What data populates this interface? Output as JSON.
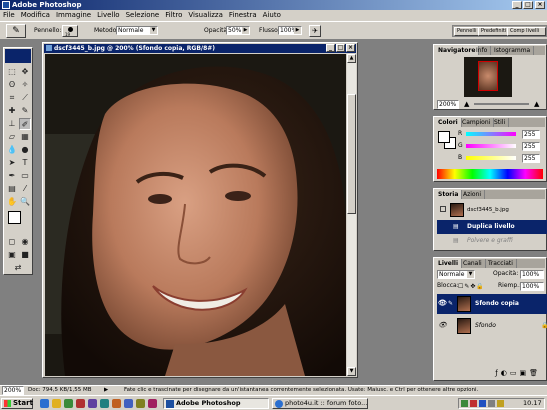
{
  "app": {
    "title": "Adobe Photoshop"
  },
  "menu": [
    "File",
    "Modifica",
    "Immagine",
    "Livello",
    "Selezione",
    "Filtro",
    "Visualizza",
    "Finestra",
    "Aiuto"
  ],
  "options": {
    "brush_label": "Pennello:",
    "brush_size": "19",
    "mode_label": "Metodo:",
    "mode_value": "Normale",
    "opacity_label": "Opacità:",
    "opacity_value": "50%",
    "flow_label": "Flusso:",
    "flow_value": "100%"
  },
  "panel_well": {
    "tab1": "Pennelli",
    "tab2": "Predefiniti",
    "tab3": "Comp livelli"
  },
  "document": {
    "title": "dscf3445_b.jpg @ 200% (Sfondo copia, RGB/8#)"
  },
  "navigator": {
    "tabs": [
      "Navigatore",
      "Info",
      "Istogramma"
    ],
    "zoom": "200%"
  },
  "color": {
    "tabs": [
      "Colori",
      "Campioni",
      "Stili"
    ],
    "channels": [
      {
        "label": "R",
        "value": "255",
        "gradient": "#ff0000"
      },
      {
        "label": "G",
        "value": "255",
        "gradient": "#00ff00"
      },
      {
        "label": "B",
        "value": "255",
        "gradient": "#0000ff"
      }
    ]
  },
  "history": {
    "tabs": [
      "Storia",
      "Azioni"
    ],
    "snapshot": "dscf3445_b.jpg",
    "items": [
      {
        "label": "Duplica livello",
        "state": "selected"
      },
      {
        "label": "Polvere e graffi",
        "state": "undone"
      }
    ]
  },
  "layers": {
    "tabs": [
      "Livelli",
      "Canali",
      "Tracciati"
    ],
    "blend": "Normale",
    "opacity_label": "Opacità:",
    "opacity_value": "100%",
    "lock_label": "Blocca:",
    "fill_label": "Riemp.:",
    "fill_value": "100%",
    "items": [
      {
        "name": "Sfondo copia",
        "selected": true
      },
      {
        "name": "Sfondo",
        "selected": false
      }
    ]
  },
  "status": {
    "zoom": "200%",
    "doc": "Doc: 794,5 KB/1,55 MB",
    "hint": "Fate clic e trascinate per disegnare da un'istantanea correntemente selezionata. Usate: Maiusc. e Ctrl per ottenere altre opzioni."
  },
  "taskbar": {
    "start": "Start",
    "tasks": [
      {
        "label": "Adobe Photoshop",
        "active": true
      },
      {
        "label": "photo4u.it :: forum foto...",
        "active": false
      }
    ],
    "clock": "10.17"
  },
  "colors": {
    "title_active": "#0a246a",
    "chrome": "#d4d0c8",
    "workspace": "#808080",
    "selection": "#0a246a"
  }
}
